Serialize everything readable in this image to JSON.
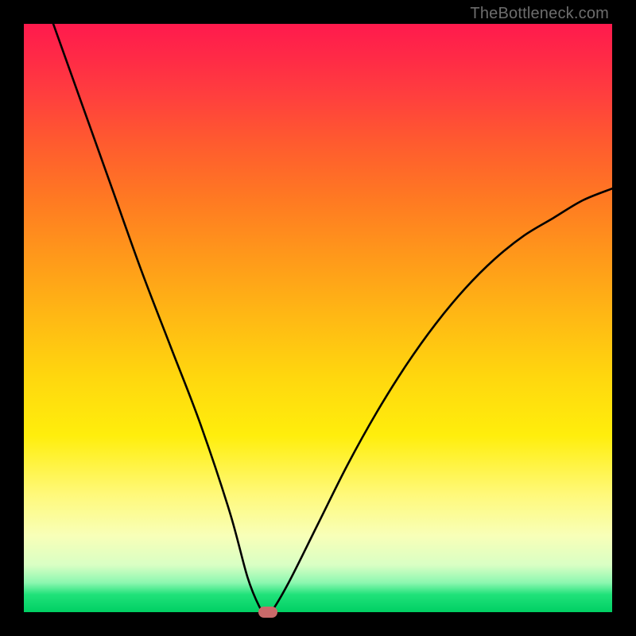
{
  "watermark": "TheBottleneck.com",
  "gradient": {
    "top": "#ff1a4d",
    "bottom": "#00cf63"
  },
  "chart_data": {
    "type": "line",
    "title": "",
    "xlabel": "",
    "ylabel": "",
    "xlim": [
      0,
      100
    ],
    "ylim": [
      0,
      100
    ],
    "grid": false,
    "legend": false,
    "series": [
      {
        "name": "curve",
        "x": [
          5,
          10,
          15,
          20,
          25,
          30,
          35,
          38,
          40,
          41,
          42,
          45,
          50,
          55,
          60,
          65,
          70,
          75,
          80,
          85,
          90,
          95,
          100
        ],
        "y": [
          100,
          86,
          72,
          58,
          45,
          32,
          17,
          6,
          1,
          0,
          0,
          5,
          15,
          25,
          34,
          42,
          49,
          55,
          60,
          64,
          67,
          70,
          72
        ]
      }
    ],
    "marker": {
      "x": 41.5,
      "y": 0
    }
  }
}
